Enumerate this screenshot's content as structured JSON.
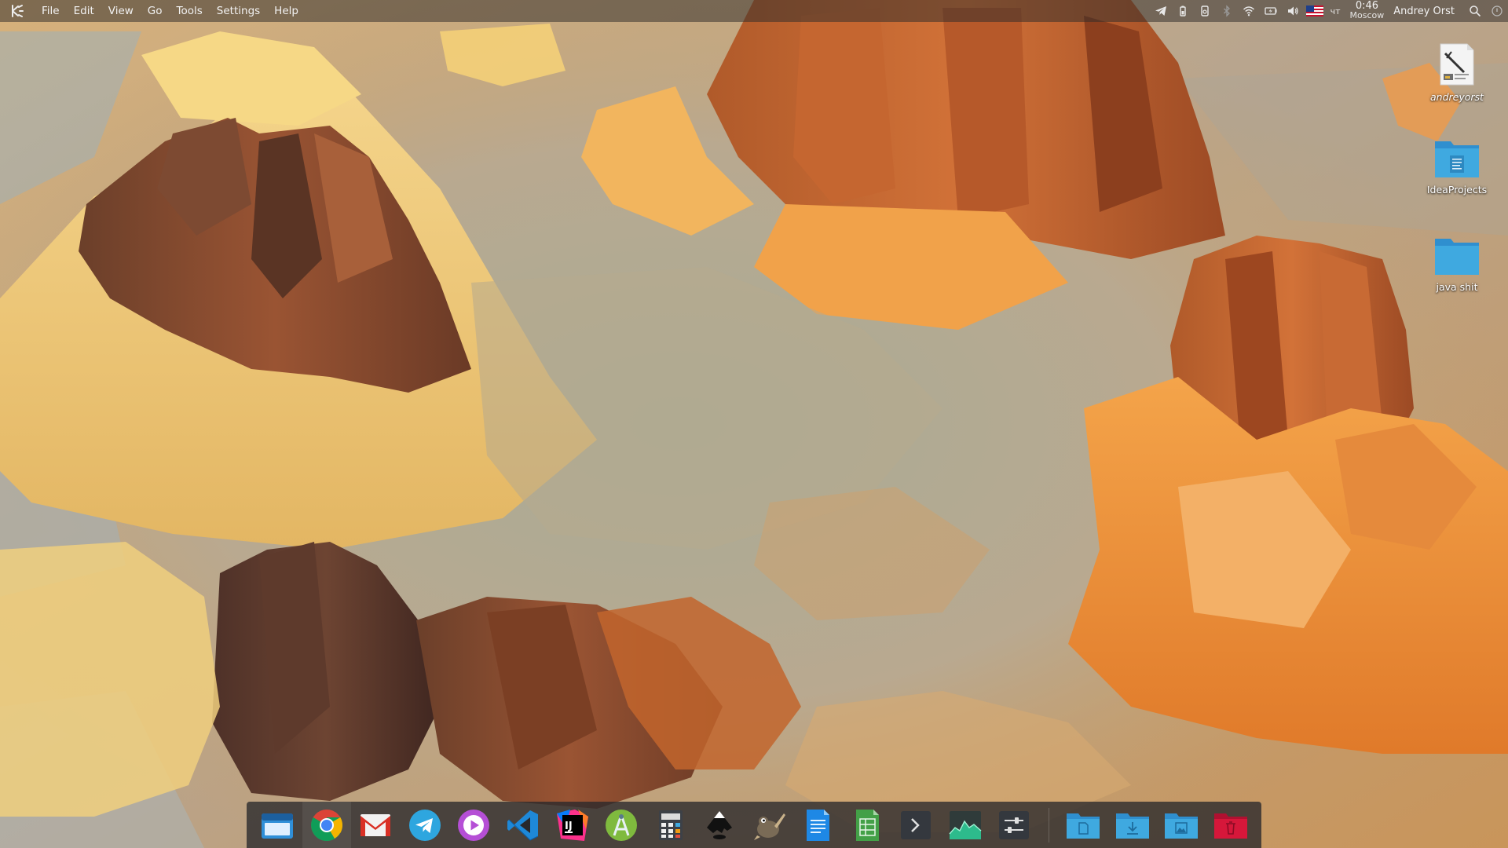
{
  "menubar": {
    "logo_icon": "kde-logo-icon",
    "menus": [
      "File",
      "Edit",
      "View",
      "Go",
      "Tools",
      "Settings",
      "Help"
    ],
    "tray_icons": [
      "telegram-icon",
      "battery-usb-icon",
      "device-icon",
      "bluetooth-icon",
      "wifi-icon",
      "battery-icon",
      "volume-icon",
      "us-flag-icon"
    ],
    "day": "чт",
    "time": "0:46",
    "timezone": "Moscow",
    "user": "Andrey Orst",
    "search_icon": "search-icon",
    "power_icon": "power-icon"
  },
  "desktop": {
    "icons": [
      {
        "label": "andreyorst",
        "icon": "notes-file-icon"
      },
      {
        "label": "IdeaProjects",
        "icon": "folder-documents-icon"
      },
      {
        "label": "java shit",
        "icon": "folder-icon"
      }
    ]
  },
  "dock": {
    "apps": [
      "file-manager-icon",
      "chrome-icon",
      "gmail-icon",
      "telegram-icon",
      "media-player-icon",
      "vscode-icon",
      "intellij-icon",
      "android-studio-icon",
      "calculator-icon",
      "inkscape-icon",
      "gimp-icon",
      "writer-icon",
      "calc-sheet-icon",
      "terminal-icon",
      "system-monitor-icon",
      "settings-icon"
    ],
    "places": [
      "documents-folder-icon",
      "downloads-folder-icon",
      "pictures-folder-icon",
      "trash-icon"
    ]
  },
  "colors": {
    "menubar_bg": "#302c2a",
    "dock_bg": "#28282c",
    "folder_blue": "#3fa9e0",
    "trash_red": "#d6173a"
  }
}
